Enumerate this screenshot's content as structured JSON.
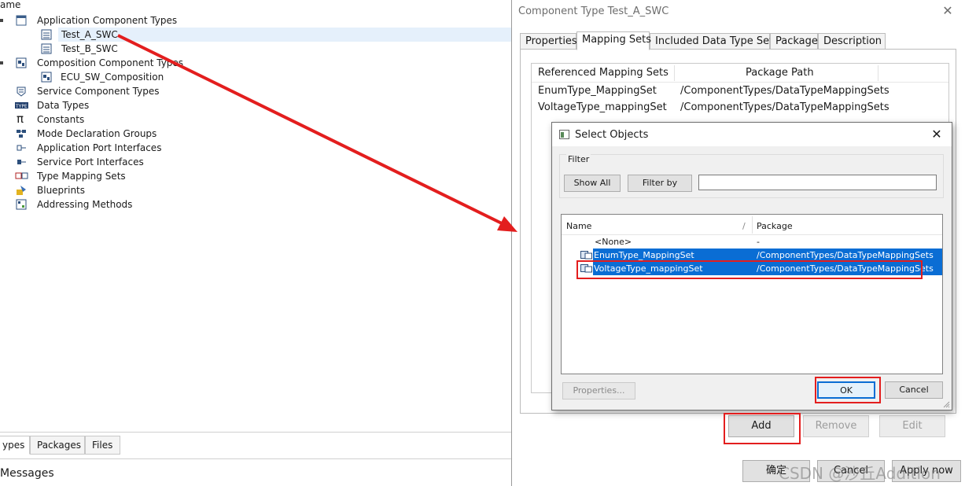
{
  "tree": {
    "header_fragment": "ame",
    "items": [
      {
        "label": "Application Component Types"
      },
      {
        "label": "Test_A_SWC"
      },
      {
        "label": "Test_B_SWC"
      },
      {
        "label": "Composition Component Types"
      },
      {
        "label": "ECU_SW_Composition"
      },
      {
        "label": "Service Component Types"
      },
      {
        "label": "Data Types"
      },
      {
        "label": "Constants"
      },
      {
        "label": "Mode Declaration Groups"
      },
      {
        "label": "Application Port Interfaces"
      },
      {
        "label": "Service Port Interfaces"
      },
      {
        "label": "Type Mapping Sets"
      },
      {
        "label": "Blueprints"
      },
      {
        "label": "Addressing Methods"
      }
    ],
    "bottom_tabs": [
      "ypes",
      "Packages",
      "Files"
    ],
    "messages_fragment": "Messages"
  },
  "properties": {
    "title": "Component Type Test_A_SWC",
    "tabs": [
      "Properties",
      "Mapping Sets",
      "Included Data Type Sets",
      "Package",
      "Description"
    ],
    "table": {
      "columns": [
        "Referenced Mapping Sets",
        "Package Path"
      ],
      "rows": [
        {
          "name": "EnumType_MappingSet",
          "path": "/ComponentTypes/DataTypeMappingSets"
        },
        {
          "name": "VoltageType_mappingSet",
          "path": "/ComponentTypes/DataTypeMappingSets"
        }
      ]
    },
    "buttons": {
      "add": "Add",
      "remove": "Remove",
      "edit": "Edit"
    },
    "footer": {
      "ok": "确定",
      "cancel": "Cancel",
      "apply": "Apply now"
    }
  },
  "dialog": {
    "title": "Select Objects",
    "filter_label": "Filter",
    "show_all": "Show All",
    "filter_by": "Filter by",
    "filter_value": "",
    "columns": [
      "Name",
      "Package"
    ],
    "rows": [
      {
        "name": "<None>",
        "package": "-",
        "selected": false
      },
      {
        "name": "EnumType_MappingSet",
        "package": "/ComponentTypes/DataTypeMappingSets",
        "selected": true
      },
      {
        "name": "VoltageType_mappingSet",
        "package": "/ComponentTypes/DataTypeMappingSets",
        "selected": true
      }
    ],
    "properties_btn": "Properties...",
    "ok": "OK",
    "cancel": "Cancel"
  },
  "watermark": "CSDN @沙丘Addition",
  "colors": {
    "selection": "#0a6dd4",
    "annotation": "#e31e1e",
    "tree_selection": "#e5f0fb"
  }
}
